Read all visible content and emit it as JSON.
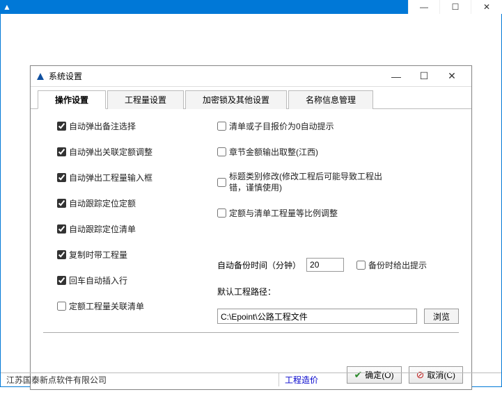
{
  "outerWindow": {
    "titlePrefix": "▲"
  },
  "dialog": {
    "title": "系统设置"
  },
  "tabs": [
    {
      "label": "操作设置",
      "active": true
    },
    {
      "label": "工程量设置",
      "active": false
    },
    {
      "label": "加密锁及其他设置",
      "active": false
    },
    {
      "label": "名称信息管理",
      "active": false
    }
  ],
  "leftOptions": [
    {
      "label": "自动弹出备注选择",
      "checked": true
    },
    {
      "label": "自动弹出关联定额调整",
      "checked": true
    },
    {
      "label": "自动弹出工程量输入框",
      "checked": true
    },
    {
      "label": "自动跟踪定位定额",
      "checked": true
    },
    {
      "label": "自动跟踪定位清单",
      "checked": true
    },
    {
      "label": "复制时带工程量",
      "checked": true
    },
    {
      "label": "回车自动插入行",
      "checked": true
    },
    {
      "label": "定额工程量关联清单",
      "checked": false
    }
  ],
  "rightOptions": [
    {
      "label": "清单或子目报价为0自动提示",
      "checked": false
    },
    {
      "label": "章节金额输出取整(江西)",
      "checked": false
    },
    {
      "label": "标题类别修改(修改工程后可能导致工程出错，谨慎使用)",
      "checked": false
    },
    {
      "label": "定额与清单工程量等比例调整",
      "checked": false
    }
  ],
  "backup": {
    "label": "自动备份时间（分钟）",
    "value": "20",
    "hintLabel": "备份时给出提示",
    "hintChecked": false
  },
  "path": {
    "label": "默认工程路径：",
    "value": "C:\\Epoint\\公路工程文件",
    "browse": "浏览"
  },
  "buttons": {
    "ok": "确定(O)",
    "cancel": "取消(C)"
  },
  "status": {
    "company": "江苏国泰新点软件有限公司",
    "product": "工程造价"
  }
}
